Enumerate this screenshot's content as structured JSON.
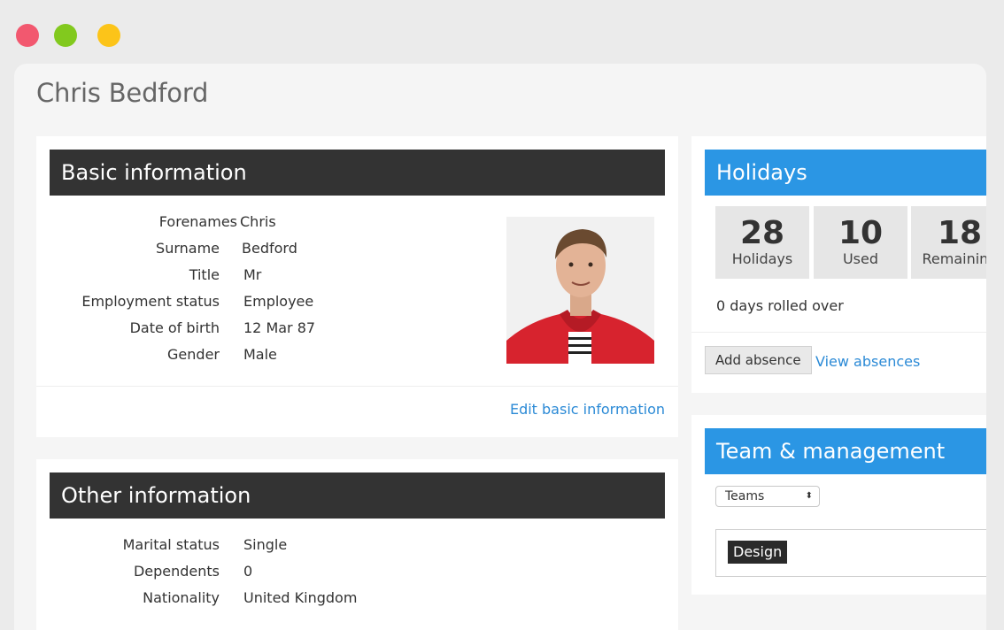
{
  "page": {
    "title": "Chris Bedford"
  },
  "basic": {
    "header": "Basic information",
    "fields": [
      {
        "label": "Forenames",
        "value": "Chris"
      },
      {
        "label": "Surname",
        "value": "Bedford"
      },
      {
        "label": "Title",
        "value": "Mr"
      },
      {
        "label": "Employment status",
        "value": "Employee"
      },
      {
        "label": "Date of birth",
        "value": "12 Mar 87"
      },
      {
        "label": "Gender",
        "value": "Male"
      }
    ],
    "edit_link": "Edit basic information"
  },
  "other": {
    "header": "Other information",
    "fields": [
      {
        "label": "Marital status",
        "value": "Single"
      },
      {
        "label": "Dependents",
        "value": "0"
      },
      {
        "label": "Nationality",
        "value": "United Kingdom"
      }
    ]
  },
  "holidays": {
    "header": "Holidays",
    "stats": [
      {
        "value": "28",
        "caption": "Holidays"
      },
      {
        "value": "10",
        "caption": "Used"
      },
      {
        "value": "18",
        "caption": "Remaining"
      }
    ],
    "rolled_over": "0 days rolled over",
    "add_button": "Add absence",
    "view_link": "View absences"
  },
  "team": {
    "header": "Team & management",
    "select_value": "Teams",
    "select_arrows": "⬍",
    "tag": "Design"
  },
  "colors": {
    "accent_blue": "#2b96e4",
    "header_dark": "#333333",
    "link": "#2b8ad6",
    "dot_red": "#f2586f",
    "dot_green": "#82c91e",
    "dot_yellow": "#fcc419"
  }
}
